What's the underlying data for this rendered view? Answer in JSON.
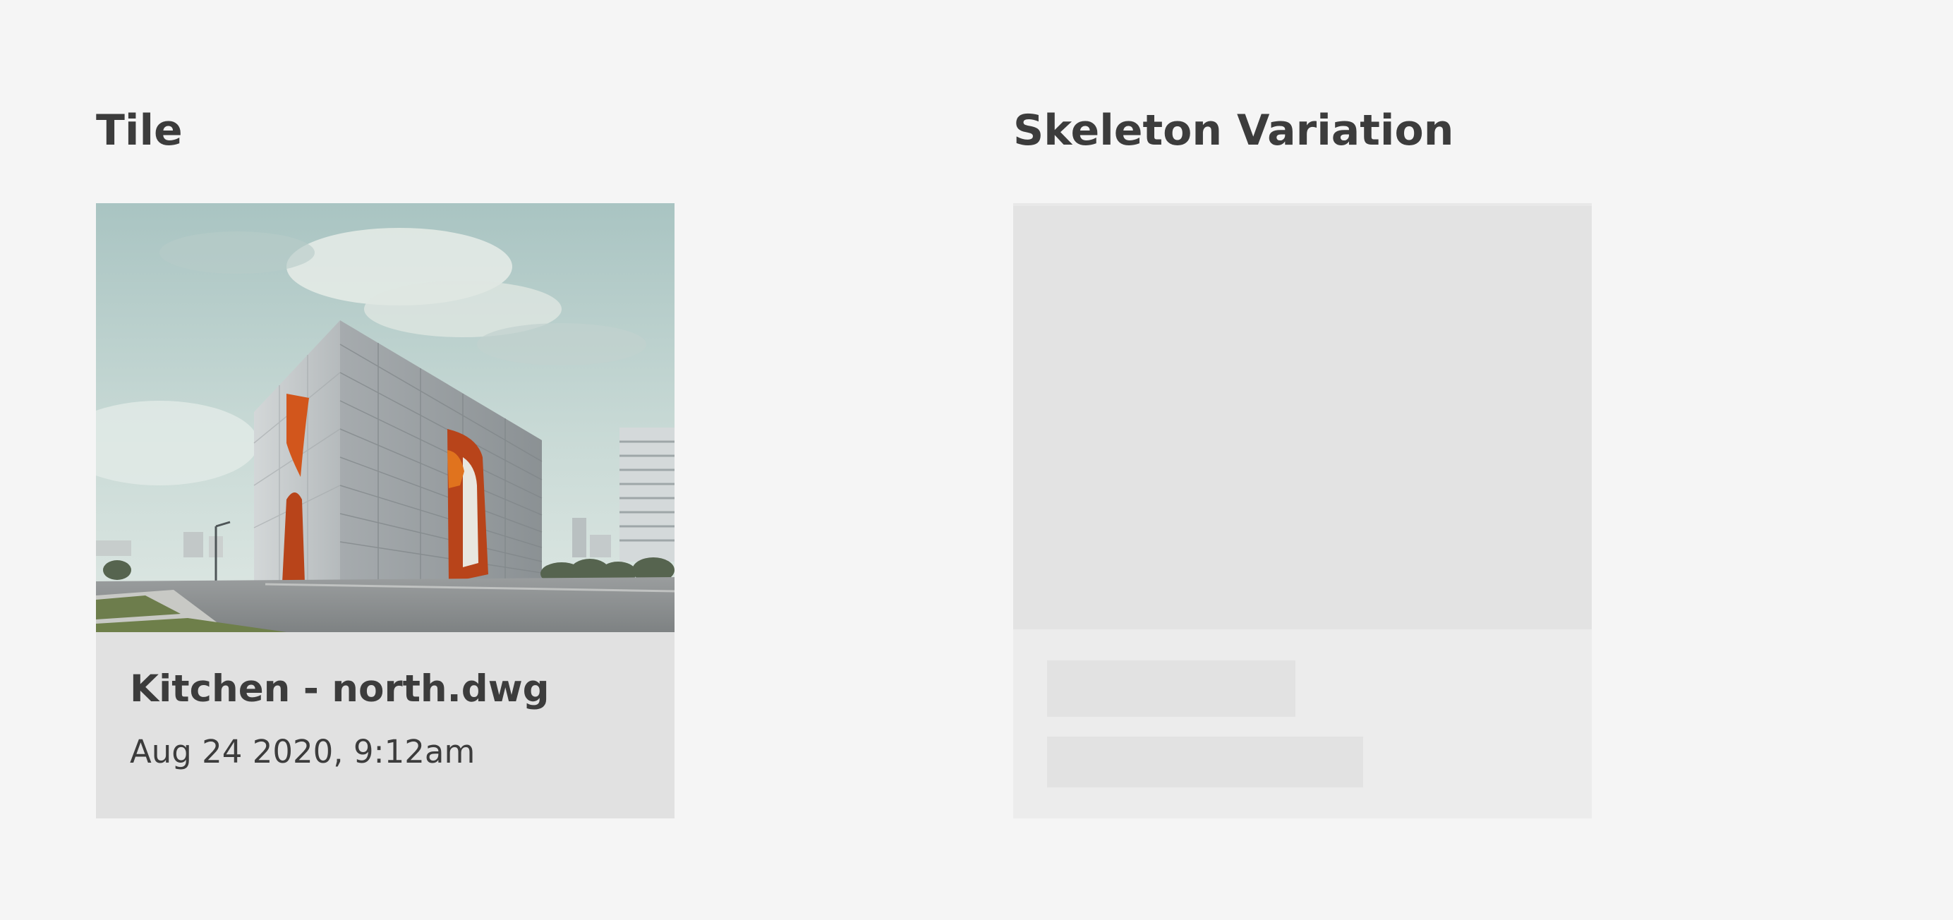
{
  "sections": {
    "tile_title": "Tile",
    "skeleton_title": "Skeleton Variation"
  },
  "tile": {
    "name": "Kitchen - north.dwg",
    "date": "Aug 24 2020, 9:12am",
    "thumbnail_icon": "building-photo"
  },
  "colors": {
    "background": "#f5f5f5",
    "tile_footer": "#e1e1e1",
    "skeleton_footer": "#ececec",
    "skeleton_block": "#e3e3e3",
    "text": "#3c3c3c",
    "accent_orange": "#d2561c"
  }
}
